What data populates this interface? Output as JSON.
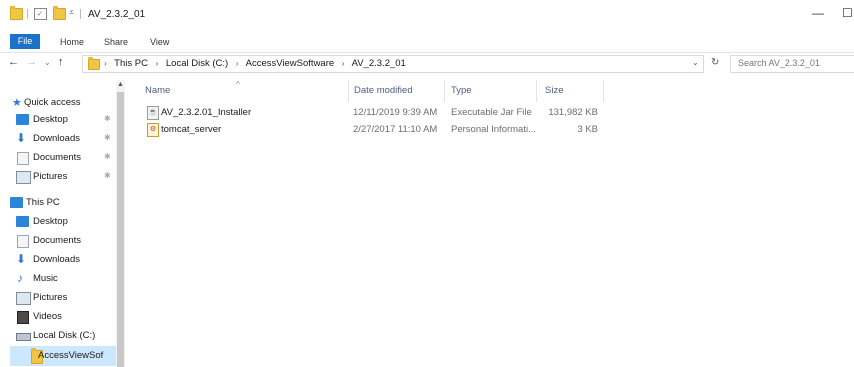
{
  "window": {
    "title": "AV_2.3.2_01",
    "minimize_glyph": "—",
    "maximize_glyph": "☐"
  },
  "ribbon": {
    "tabs": [
      "File",
      "Home",
      "Share",
      "View"
    ]
  },
  "address": {
    "crumbs": [
      "This PC",
      "Local Disk (C:)",
      "AccessViewSoftware",
      "AV_2.3.2_01"
    ],
    "search_placeholder": "Search AV_2.3.2_01"
  },
  "nav_pane": {
    "quick_access": {
      "label": "Quick access",
      "items": [
        {
          "label": "Desktop",
          "icon": "desktop-icon"
        },
        {
          "label": "Downloads",
          "icon": "downloads-icon"
        },
        {
          "label": "Documents",
          "icon": "documents-icon"
        },
        {
          "label": "Pictures",
          "icon": "pictures-icon"
        }
      ]
    },
    "this_pc": {
      "label": "This PC",
      "items": [
        {
          "label": "Desktop",
          "icon": "desktop-icon"
        },
        {
          "label": "Documents",
          "icon": "documents-icon"
        },
        {
          "label": "Downloads",
          "icon": "downloads-icon"
        },
        {
          "label": "Music",
          "icon": "music-icon"
        },
        {
          "label": "Pictures",
          "icon": "pictures-icon"
        },
        {
          "label": "Videos",
          "icon": "videos-icon"
        },
        {
          "label": "Local Disk (C:)",
          "icon": "drive-icon"
        },
        {
          "label": "AccessViewSof",
          "icon": "folder-icon"
        }
      ]
    }
  },
  "file_list": {
    "columns": [
      "Name",
      "Date modified",
      "Type",
      "Size"
    ],
    "rows": [
      {
        "name": "AV_2.3.2.01_Installer",
        "date": "12/11/2019 9:39 AM",
        "type": "Executable Jar File",
        "size": "131,982 KB",
        "icon": "jar-file-icon"
      },
      {
        "name": "tomcat_server",
        "date": "2/27/2017 11:10 AM",
        "type": "Personal Informati...",
        "size": "3 KB",
        "icon": "pif-file-icon"
      }
    ]
  },
  "colors": {
    "accent": "#1a73c8",
    "selected": "#cce8ff",
    "header_text": "#4d6082",
    "folder": "#f3c544"
  }
}
